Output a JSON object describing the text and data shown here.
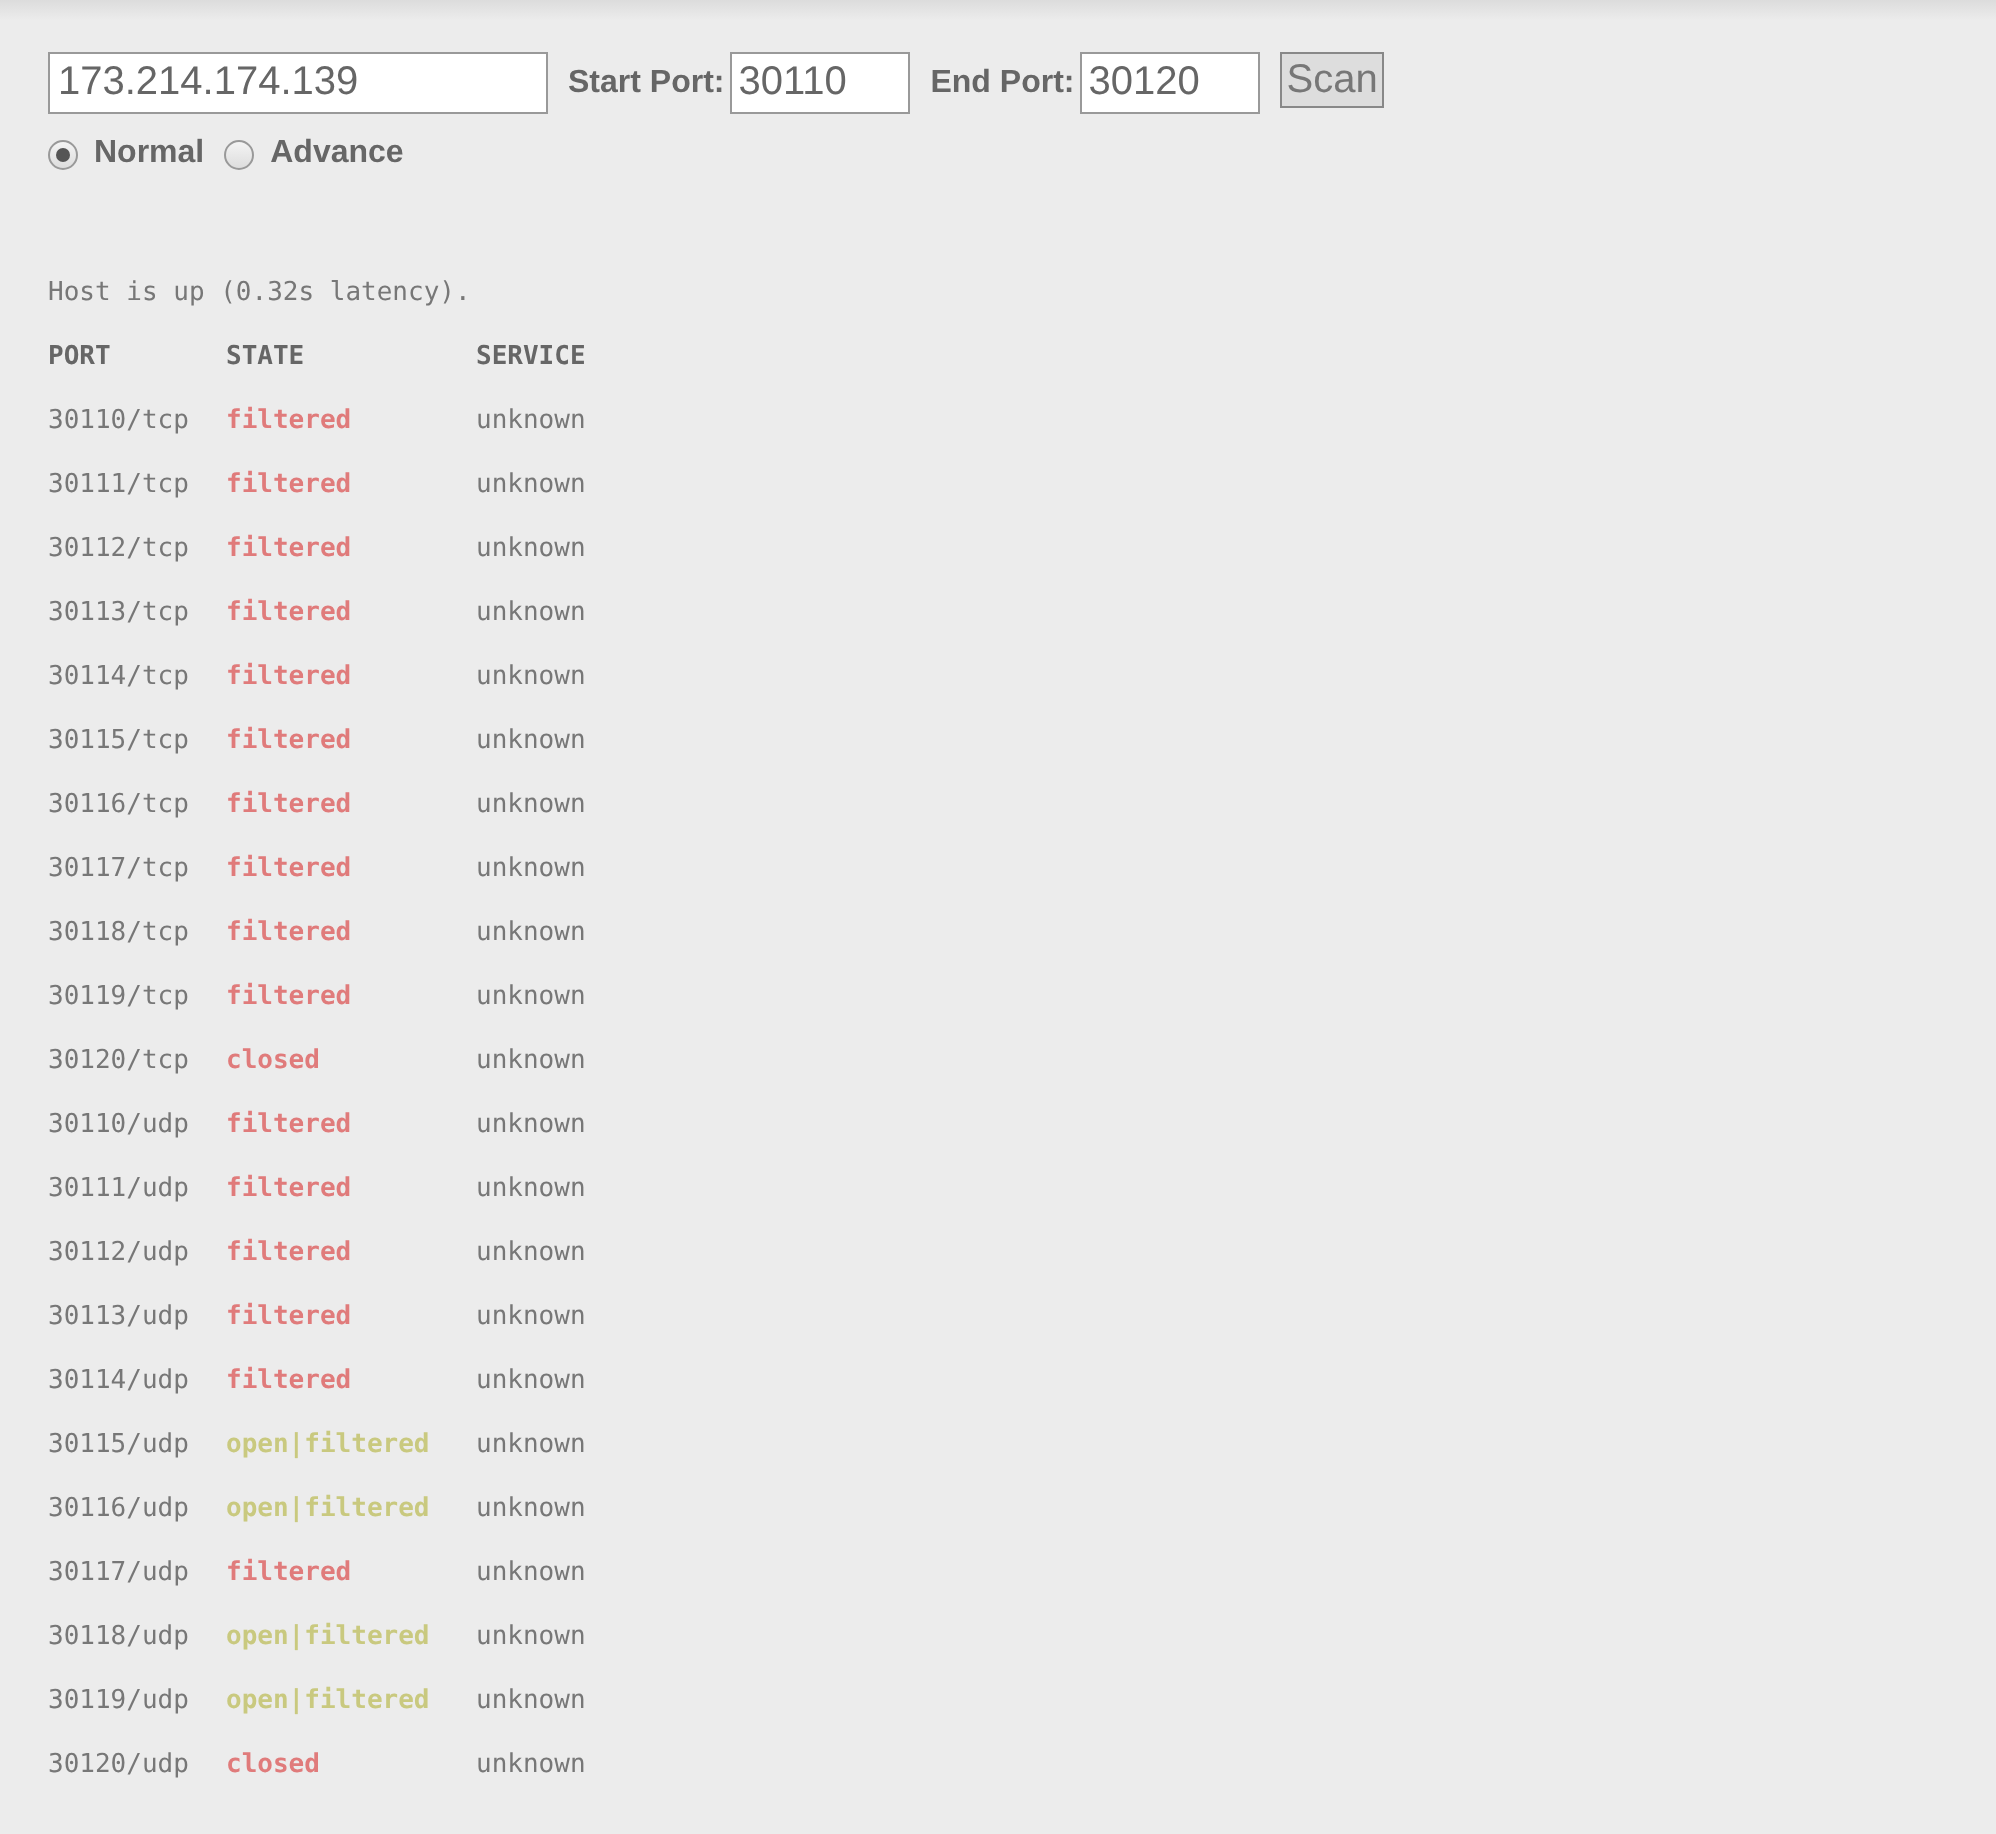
{
  "host_field": {
    "value": "173.214.174.139"
  },
  "start_port": {
    "label": "Start Port:",
    "value": "30110"
  },
  "end_port": {
    "label": "End Port:",
    "value": "30120"
  },
  "scan_button": "Scan",
  "modes": [
    {
      "label": "Normal",
      "selected": true
    },
    {
      "label": "Advance",
      "selected": false
    }
  ],
  "status": "Host is up (0.32s latency).",
  "table": {
    "columns": [
      "PORT",
      "STATE",
      "SERVICE"
    ],
    "rows": [
      {
        "port": "30110/tcp",
        "state": "filtered",
        "color": "#e07b7b",
        "service": "unknown"
      },
      {
        "port": "30111/tcp",
        "state": "filtered",
        "color": "#e07b7b",
        "service": "unknown"
      },
      {
        "port": "30112/tcp",
        "state": "filtered",
        "color": "#e07b7b",
        "service": "unknown"
      },
      {
        "port": "30113/tcp",
        "state": "filtered",
        "color": "#e07b7b",
        "service": "unknown"
      },
      {
        "port": "30114/tcp",
        "state": "filtered",
        "color": "#e07b7b",
        "service": "unknown"
      },
      {
        "port": "30115/tcp",
        "state": "filtered",
        "color": "#e07b7b",
        "service": "unknown"
      },
      {
        "port": "30116/tcp",
        "state": "filtered",
        "color": "#e07b7b",
        "service": "unknown"
      },
      {
        "port": "30117/tcp",
        "state": "filtered",
        "color": "#e07b7b",
        "service": "unknown"
      },
      {
        "port": "30118/tcp",
        "state": "filtered",
        "color": "#e07b7b",
        "service": "unknown"
      },
      {
        "port": "30119/tcp",
        "state": "filtered",
        "color": "#e07b7b",
        "service": "unknown"
      },
      {
        "port": "30120/tcp",
        "state": "closed",
        "color": "#e07b7b",
        "service": "unknown"
      },
      {
        "port": "30110/udp",
        "state": "filtered",
        "color": "#e07b7b",
        "service": "unknown"
      },
      {
        "port": "30111/udp",
        "state": "filtered",
        "color": "#e07b7b",
        "service": "unknown"
      },
      {
        "port": "30112/udp",
        "state": "filtered",
        "color": "#e07b7b",
        "service": "unknown"
      },
      {
        "port": "30113/udp",
        "state": "filtered",
        "color": "#e07b7b",
        "service": "unknown"
      },
      {
        "port": "30114/udp",
        "state": "filtered",
        "color": "#e07b7b",
        "service": "unknown"
      },
      {
        "port": "30115/udp",
        "state": "open|filtered",
        "color": "#c9c97f",
        "service": "unknown"
      },
      {
        "port": "30116/udp",
        "state": "open|filtered",
        "color": "#c9c97f",
        "service": "unknown"
      },
      {
        "port": "30117/udp",
        "state": "filtered",
        "color": "#e07b7b",
        "service": "unknown"
      },
      {
        "port": "30118/udp",
        "state": "open|filtered",
        "color": "#c9c97f",
        "service": "unknown"
      },
      {
        "port": "30119/udp",
        "state": "open|filtered",
        "color": "#c9c97f",
        "service": "unknown"
      },
      {
        "port": "30120/udp",
        "state": "closed",
        "color": "#e07b7b",
        "service": "unknown"
      }
    ]
  }
}
